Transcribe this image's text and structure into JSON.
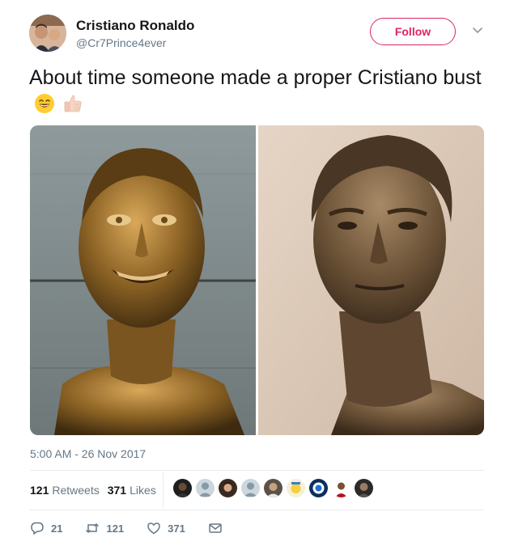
{
  "author": {
    "name": "Cristiano Ronaldo",
    "handle": "@Cr7Prince4ever"
  },
  "follow_label": "Follow",
  "tweet": {
    "text": "About time someone made a proper Cristiano bust",
    "emojis": [
      "grinning-face",
      "thumbs-up"
    ]
  },
  "media": {
    "left_image": "Bronze bust (caricature)",
    "right_image": "Bronze bust (realistic)"
  },
  "timestamp": "5:00 AM - 26 Nov 2017",
  "stats": {
    "retweets_count": "121",
    "retweets_label": "Retweets",
    "likes_count": "371",
    "likes_label": "Likes"
  },
  "likers_count": 10,
  "actions": {
    "reply_count": "21",
    "retweet_count": "121",
    "like_count": "371"
  },
  "colors": {
    "accent": "#e0245e",
    "text_primary": "#14171a",
    "text_secondary": "#657786",
    "divider": "#e6ecf0"
  }
}
